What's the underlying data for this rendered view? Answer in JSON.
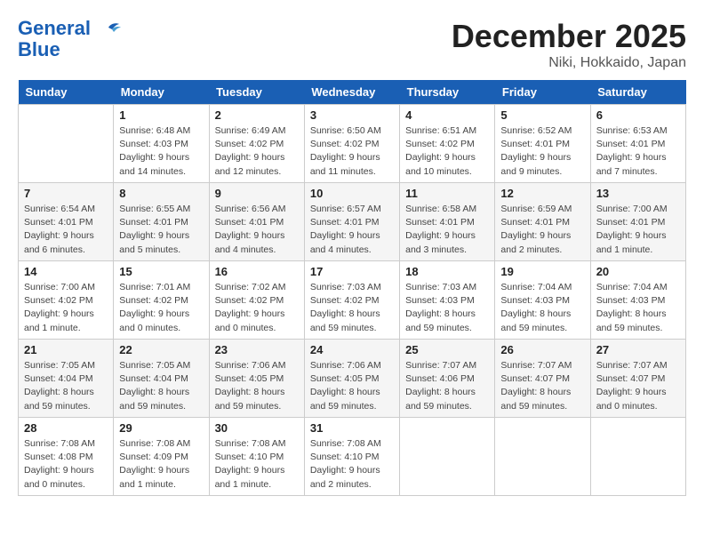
{
  "header": {
    "logo_line1": "General",
    "logo_line2": "Blue",
    "month": "December 2025",
    "location": "Niki, Hokkaido, Japan"
  },
  "weekdays": [
    "Sunday",
    "Monday",
    "Tuesday",
    "Wednesday",
    "Thursday",
    "Friday",
    "Saturday"
  ],
  "weeks": [
    [
      {
        "day": "",
        "info": ""
      },
      {
        "day": "1",
        "info": "Sunrise: 6:48 AM\nSunset: 4:03 PM\nDaylight: 9 hours\nand 14 minutes."
      },
      {
        "day": "2",
        "info": "Sunrise: 6:49 AM\nSunset: 4:02 PM\nDaylight: 9 hours\nand 12 minutes."
      },
      {
        "day": "3",
        "info": "Sunrise: 6:50 AM\nSunset: 4:02 PM\nDaylight: 9 hours\nand 11 minutes."
      },
      {
        "day": "4",
        "info": "Sunrise: 6:51 AM\nSunset: 4:02 PM\nDaylight: 9 hours\nand 10 minutes."
      },
      {
        "day": "5",
        "info": "Sunrise: 6:52 AM\nSunset: 4:01 PM\nDaylight: 9 hours\nand 9 minutes."
      },
      {
        "day": "6",
        "info": "Sunrise: 6:53 AM\nSunset: 4:01 PM\nDaylight: 9 hours\nand 7 minutes."
      }
    ],
    [
      {
        "day": "7",
        "info": "Sunrise: 6:54 AM\nSunset: 4:01 PM\nDaylight: 9 hours\nand 6 minutes."
      },
      {
        "day": "8",
        "info": "Sunrise: 6:55 AM\nSunset: 4:01 PM\nDaylight: 9 hours\nand 5 minutes."
      },
      {
        "day": "9",
        "info": "Sunrise: 6:56 AM\nSunset: 4:01 PM\nDaylight: 9 hours\nand 4 minutes."
      },
      {
        "day": "10",
        "info": "Sunrise: 6:57 AM\nSunset: 4:01 PM\nDaylight: 9 hours\nand 4 minutes."
      },
      {
        "day": "11",
        "info": "Sunrise: 6:58 AM\nSunset: 4:01 PM\nDaylight: 9 hours\nand 3 minutes."
      },
      {
        "day": "12",
        "info": "Sunrise: 6:59 AM\nSunset: 4:01 PM\nDaylight: 9 hours\nand 2 minutes."
      },
      {
        "day": "13",
        "info": "Sunrise: 7:00 AM\nSunset: 4:01 PM\nDaylight: 9 hours\nand 1 minute."
      }
    ],
    [
      {
        "day": "14",
        "info": "Sunrise: 7:00 AM\nSunset: 4:02 PM\nDaylight: 9 hours\nand 1 minute."
      },
      {
        "day": "15",
        "info": "Sunrise: 7:01 AM\nSunset: 4:02 PM\nDaylight: 9 hours\nand 0 minutes."
      },
      {
        "day": "16",
        "info": "Sunrise: 7:02 AM\nSunset: 4:02 PM\nDaylight: 9 hours\nand 0 minutes."
      },
      {
        "day": "17",
        "info": "Sunrise: 7:03 AM\nSunset: 4:02 PM\nDaylight: 8 hours\nand 59 minutes."
      },
      {
        "day": "18",
        "info": "Sunrise: 7:03 AM\nSunset: 4:03 PM\nDaylight: 8 hours\nand 59 minutes."
      },
      {
        "day": "19",
        "info": "Sunrise: 7:04 AM\nSunset: 4:03 PM\nDaylight: 8 hours\nand 59 minutes."
      },
      {
        "day": "20",
        "info": "Sunrise: 7:04 AM\nSunset: 4:03 PM\nDaylight: 8 hours\nand 59 minutes."
      }
    ],
    [
      {
        "day": "21",
        "info": "Sunrise: 7:05 AM\nSunset: 4:04 PM\nDaylight: 8 hours\nand 59 minutes."
      },
      {
        "day": "22",
        "info": "Sunrise: 7:05 AM\nSunset: 4:04 PM\nDaylight: 8 hours\nand 59 minutes."
      },
      {
        "day": "23",
        "info": "Sunrise: 7:06 AM\nSunset: 4:05 PM\nDaylight: 8 hours\nand 59 minutes."
      },
      {
        "day": "24",
        "info": "Sunrise: 7:06 AM\nSunset: 4:05 PM\nDaylight: 8 hours\nand 59 minutes."
      },
      {
        "day": "25",
        "info": "Sunrise: 7:07 AM\nSunset: 4:06 PM\nDaylight: 8 hours\nand 59 minutes."
      },
      {
        "day": "26",
        "info": "Sunrise: 7:07 AM\nSunset: 4:07 PM\nDaylight: 8 hours\nand 59 minutes."
      },
      {
        "day": "27",
        "info": "Sunrise: 7:07 AM\nSunset: 4:07 PM\nDaylight: 9 hours\nand 0 minutes."
      }
    ],
    [
      {
        "day": "28",
        "info": "Sunrise: 7:08 AM\nSunset: 4:08 PM\nDaylight: 9 hours\nand 0 minutes."
      },
      {
        "day": "29",
        "info": "Sunrise: 7:08 AM\nSunset: 4:09 PM\nDaylight: 9 hours\nand 1 minute."
      },
      {
        "day": "30",
        "info": "Sunrise: 7:08 AM\nSunset: 4:10 PM\nDaylight: 9 hours\nand 1 minute."
      },
      {
        "day": "31",
        "info": "Sunrise: 7:08 AM\nSunset: 4:10 PM\nDaylight: 9 hours\nand 2 minutes."
      },
      {
        "day": "",
        "info": ""
      },
      {
        "day": "",
        "info": ""
      },
      {
        "day": "",
        "info": ""
      }
    ]
  ]
}
